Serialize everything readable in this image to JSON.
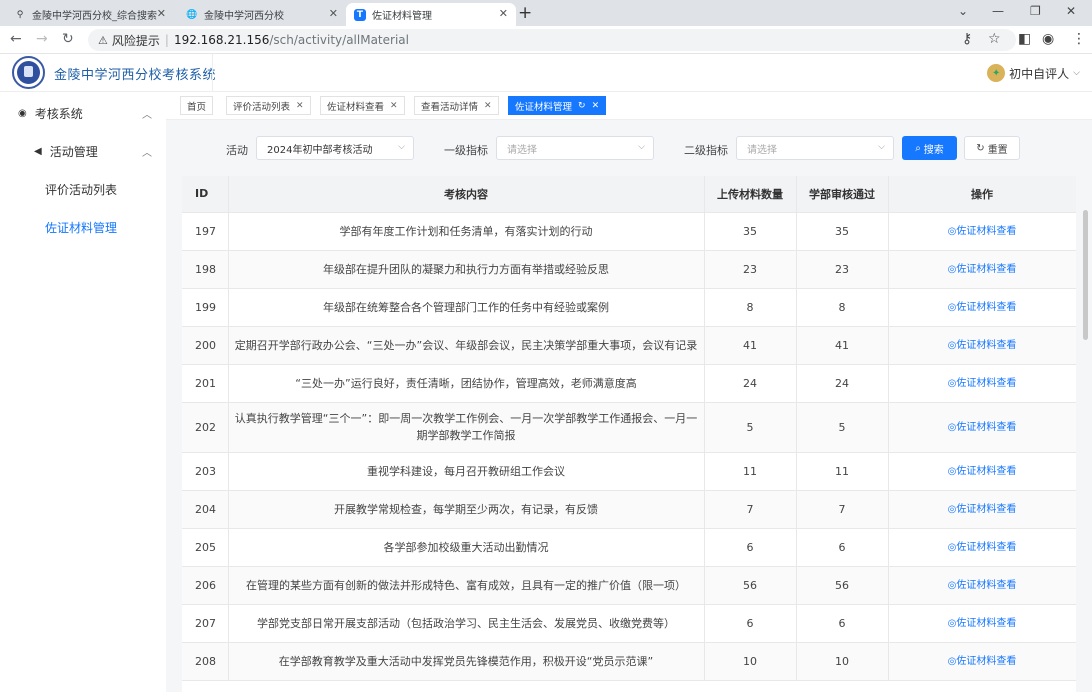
{
  "browser": {
    "tabs": [
      {
        "title": "金陵中学河西分校_综合搜索",
        "icon": "search-icon"
      },
      {
        "title": "金陵中学河西分校",
        "icon": "globe-icon"
      },
      {
        "title": "佐证材料管理",
        "icon": "app-icon",
        "icon_letter": "T"
      }
    ],
    "new_tab": "+",
    "address": {
      "warning": "风险提示",
      "host": "192.168.21.156",
      "path": "/sch/activity/allMaterial"
    }
  },
  "app": {
    "title": "金陵中学河西分校考核系统",
    "user": "初中自评人"
  },
  "sidebar": {
    "items": [
      {
        "label": "考核系统"
      },
      {
        "label": "活动管理"
      },
      {
        "label": "评价活动列表"
      },
      {
        "label": "佐证材料管理"
      }
    ]
  },
  "breadcrumb_tabs": [
    {
      "label": "首页"
    },
    {
      "label": "评价活动列表"
    },
    {
      "label": "佐证材料查看"
    },
    {
      "label": "查看活动详情"
    },
    {
      "label": "佐证材料管理"
    }
  ],
  "filters": {
    "activity_label": "活动",
    "activity_value": "2024年初中部考核活动",
    "level1_label": "一级指标",
    "level1_placeholder": "请选择",
    "level2_label": "二级指标",
    "level2_placeholder": "请选择",
    "search_label": "搜索",
    "reset_label": "重置"
  },
  "table": {
    "headers": [
      "ID",
      "考核内容",
      "上传材料数量",
      "学部审核通过",
      "操作"
    ],
    "action_label": "佐证材料查看",
    "rows": [
      {
        "id": "197",
        "content": "学部有年度工作计划和任务清单，有落实计划的行动",
        "uploaded": "35",
        "approved": "35"
      },
      {
        "id": "198",
        "content": "年级部在提升团队的凝聚力和执行力方面有举措或经验反思",
        "uploaded": "23",
        "approved": "23"
      },
      {
        "id": "199",
        "content": "年级部在统筹整合各个管理部门工作的任务中有经验或案例",
        "uploaded": "8",
        "approved": "8"
      },
      {
        "id": "200",
        "content": "定期召开学部行政办公会、“三处一办”会议、年级部会议，民主决策学部重大事项，会议有记录",
        "uploaded": "41",
        "approved": "41"
      },
      {
        "id": "201",
        "content": "“三处一办”运行良好，责任清晰，团结协作，管理高效，老师满意度高",
        "uploaded": "24",
        "approved": "24"
      },
      {
        "id": "202",
        "content": "认真执行教学管理“三个一”：即一周一次教学工作例会、一月一次学部教学工作通报会、一月一期学部教学工作简报",
        "uploaded": "5",
        "approved": "5"
      },
      {
        "id": "203",
        "content": "重视学科建设，每月召开教研组工作会议",
        "uploaded": "11",
        "approved": "11"
      },
      {
        "id": "204",
        "content": "开展教学常规检查，每学期至少两次，有记录，有反馈",
        "uploaded": "7",
        "approved": "7"
      },
      {
        "id": "205",
        "content": "各学部参加校级重大活动出勤情况",
        "uploaded": "6",
        "approved": "6"
      },
      {
        "id": "206",
        "content": "在管理的某些方面有创新的做法并形成特色、富有成效，且具有一定的推广价值（限一项）",
        "uploaded": "56",
        "approved": "56"
      },
      {
        "id": "207",
        "content": "学部党支部日常开展支部活动（包括政治学习、民主生活会、发展党员、收缴党费等）",
        "uploaded": "6",
        "approved": "6"
      },
      {
        "id": "208",
        "content": "在学部教育教学及重大活动中发挥党员先锋模范作用，积极开设“党员示范课”",
        "uploaded": "10",
        "approved": "10"
      }
    ]
  },
  "colors": {
    "accent": "#1677ff",
    "brand": "#1f5fa8"
  }
}
